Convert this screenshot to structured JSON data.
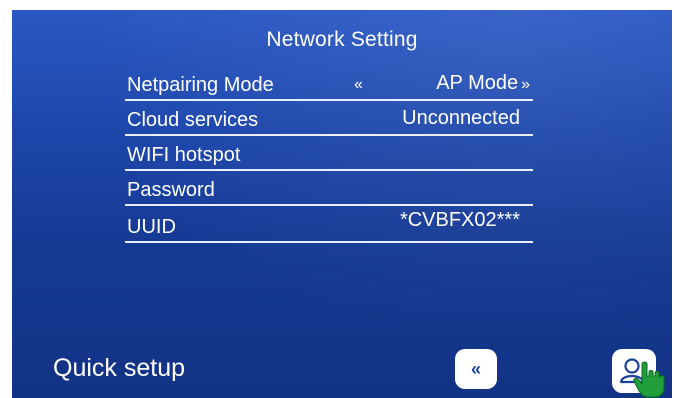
{
  "title": "Network Setting",
  "rows": [
    {
      "label": "Netpairing Mode",
      "value": "AP Mode",
      "left_arrow": "«",
      "right_arrow": "»"
    },
    {
      "label": "Cloud services",
      "value": "Unconnected"
    },
    {
      "label": "WIFI hotspot",
      "value": ""
    },
    {
      "label": "Password",
      "value": ""
    },
    {
      "label": "UUID",
      "value": "*CVBFX02***"
    }
  ],
  "footer": {
    "quick_setup_label": "Quick setup",
    "back_icon": "double-left-arrow-icon",
    "user_icon": "user-icon",
    "pointer_icon": "hand-pointer-icon"
  },
  "colors": {
    "background": "#1d47ac",
    "text": "#ffffff",
    "divider": "#e8eefc",
    "pointer": "#1f9e3a"
  }
}
